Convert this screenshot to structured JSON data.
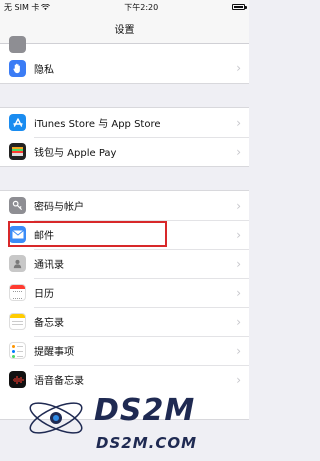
{
  "status": {
    "carrier": "无 SIM 卡",
    "time": "下午2:20"
  },
  "nav": {
    "title": "设置"
  },
  "items": {
    "privacy": "隐私",
    "itunes": "iTunes Store 与 App Store",
    "wallet": "钱包与 Apple Pay",
    "passwords": "密码与帐户",
    "mail": "邮件",
    "contacts": "通讯录",
    "calendar": "日历",
    "notes": "备忘录",
    "reminders": "提醒事项",
    "voicememos": "语音备忘录"
  },
  "watermark": {
    "logo": "DS2M",
    "url": "DS2M.COM"
  },
  "colors": {
    "accent_blue": "#3b7cf5",
    "highlight_red": "#d8282a",
    "appstore_blue": "#1a8cf0"
  }
}
